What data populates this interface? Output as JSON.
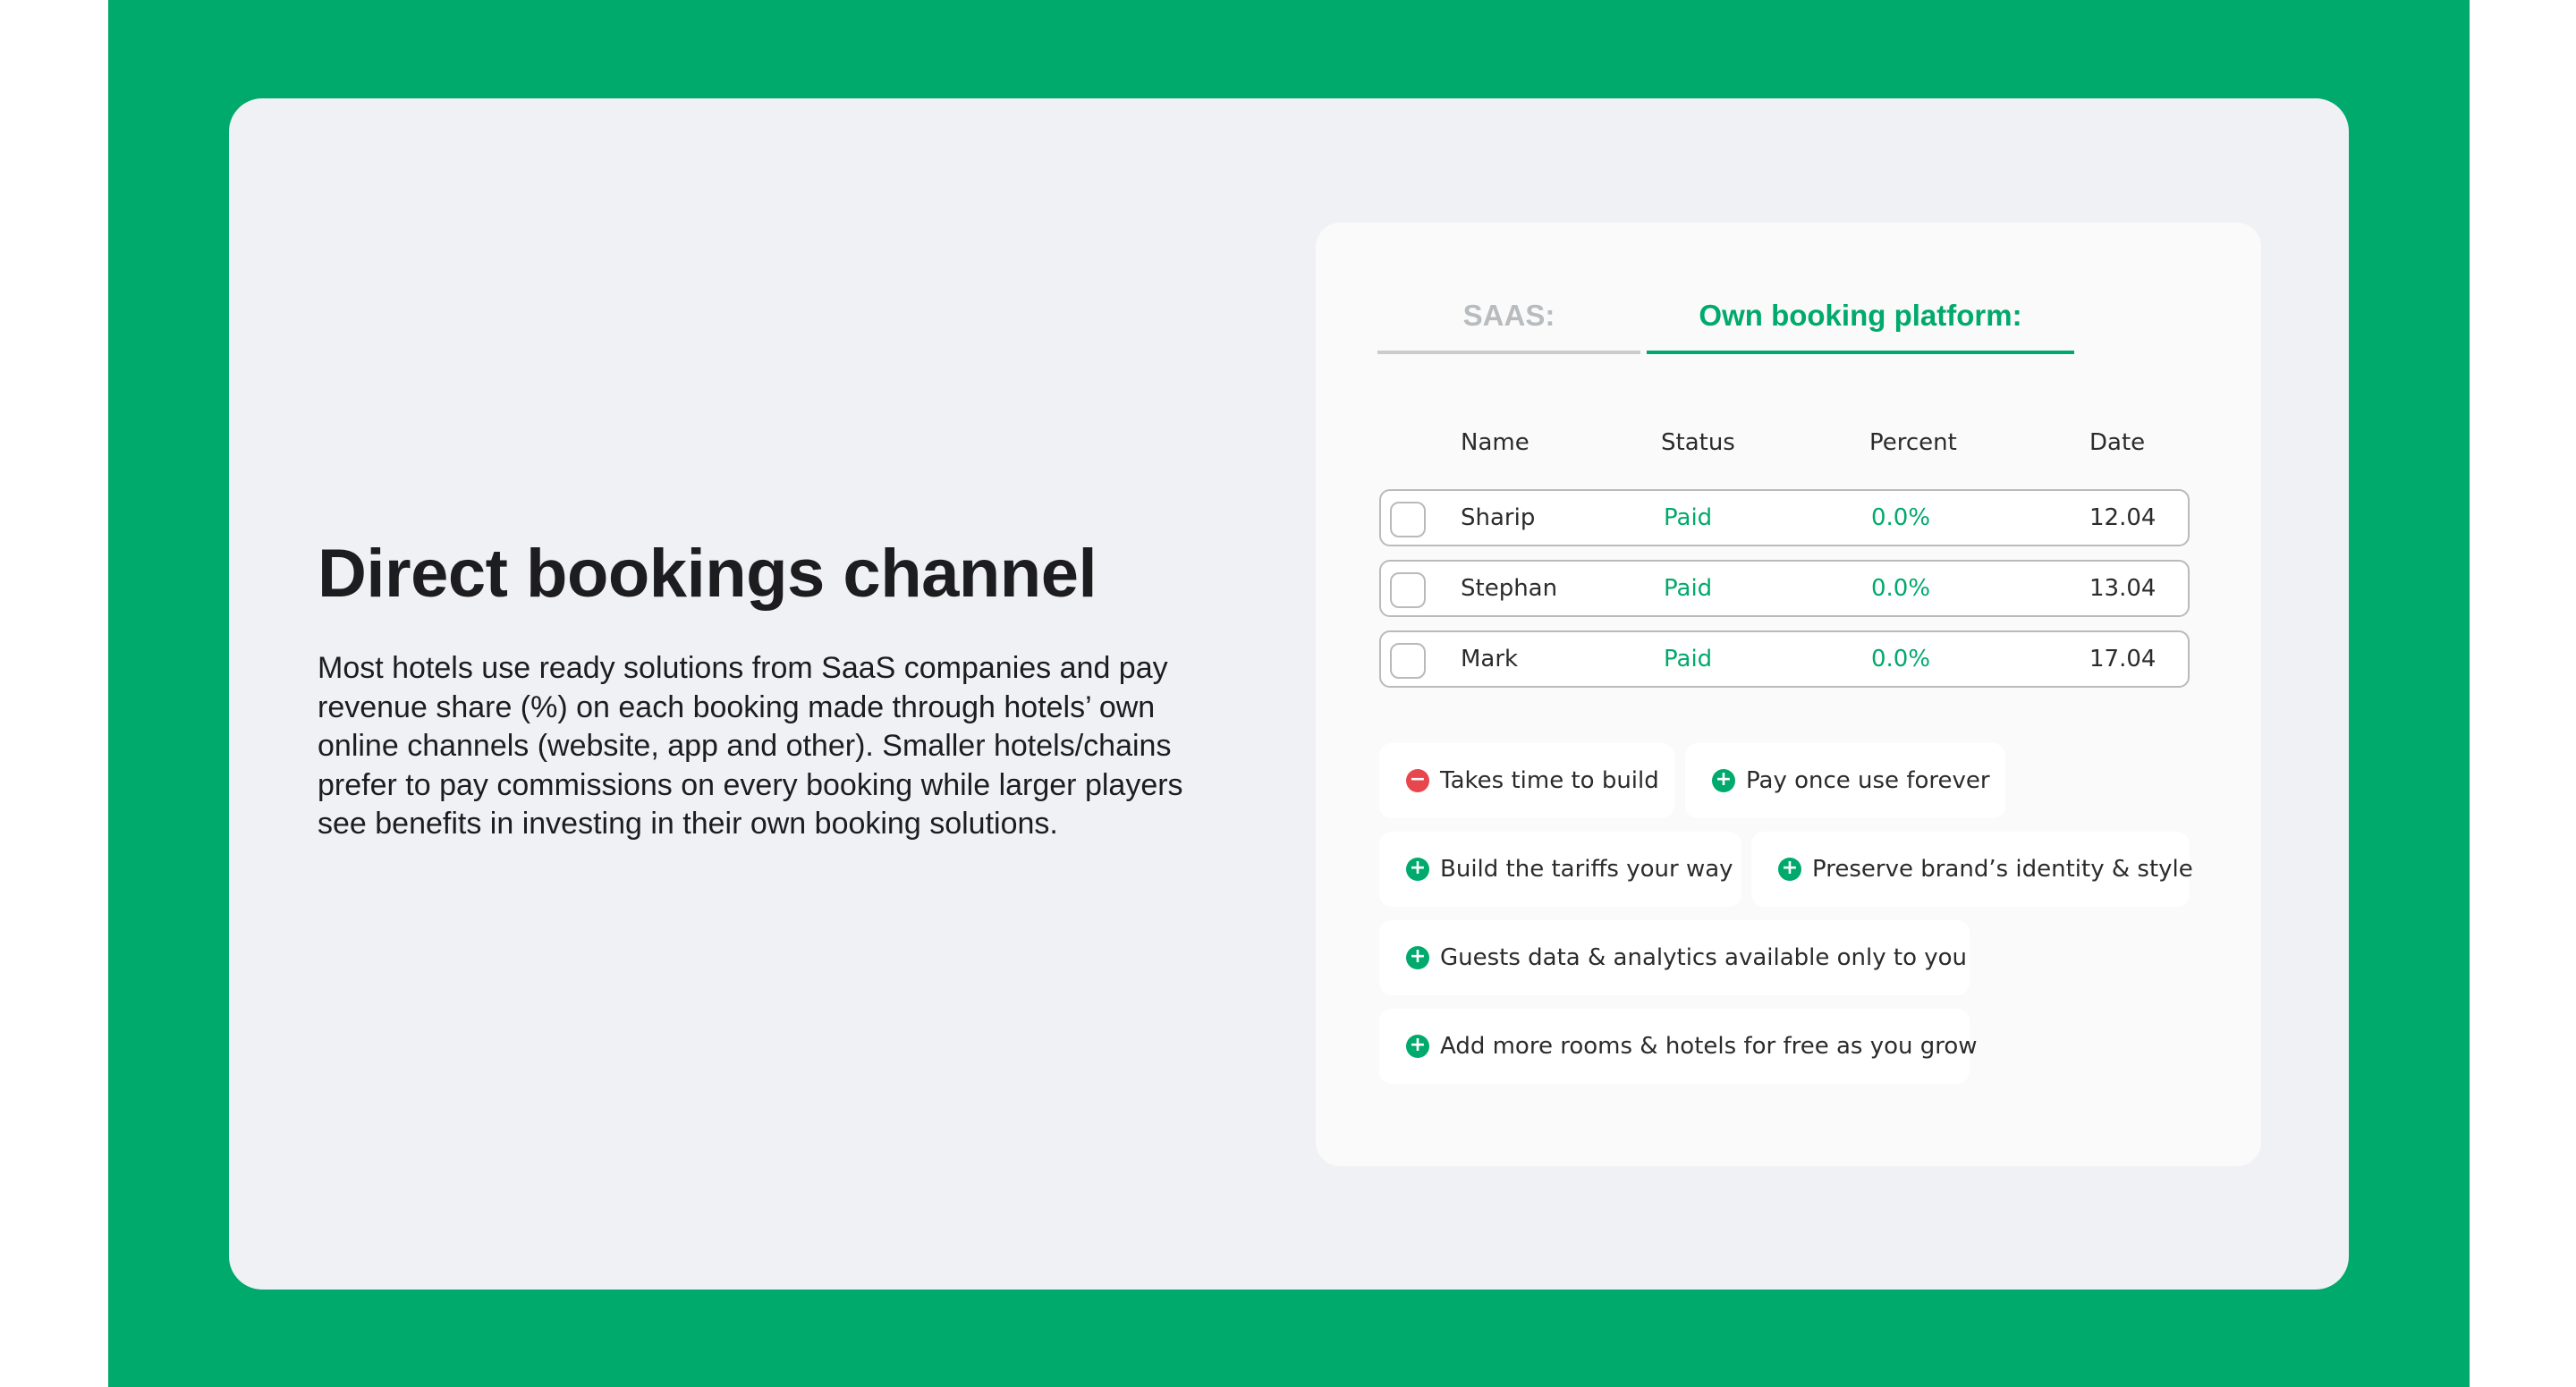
{
  "left": {
    "title": "Direct bookings channel",
    "description": "Most hotels use ready solutions from SaaS companies and pay revenue share (%) on each booking made through hotels’ own online channels (website, app and other). Smaller hotels/chains prefer to pay commissions on every booking while larger players see benefits in investing in their own booking solutions."
  },
  "tabs": [
    {
      "label": "SAAS:",
      "active": false
    },
    {
      "label": "Own booking platform:",
      "active": true
    }
  ],
  "table": {
    "headers": [
      "Name",
      "Status",
      "Percent",
      "Date"
    ],
    "rows": [
      {
        "name": "Sharip",
        "status": "Paid",
        "percent": "0.0%",
        "date": "12.04"
      },
      {
        "name": "Stephan",
        "status": "Paid",
        "percent": "0.0%",
        "date": "13.04"
      },
      {
        "name": "Mark",
        "status": "Paid",
        "percent": "0.0%",
        "date": "17.04"
      }
    ]
  },
  "features": [
    {
      "label": "Takes time to build",
      "kind": "minus",
      "icon": "minus-circle-icon"
    },
    {
      "label": "Pay once use forever",
      "kind": "plus",
      "icon": "plus-circle-icon"
    },
    {
      "label": "Build the tariffs your way",
      "kind": "plus",
      "icon": "plus-circle-icon"
    },
    {
      "label": "Preserve brand’s identity & style",
      "kind": "plus",
      "icon": "plus-circle-icon"
    },
    {
      "label": "Guests data & analytics available only to you",
      "kind": "plus",
      "icon": "plus-circle-icon"
    },
    {
      "label": "Add more rooms & hotels for free as you grow",
      "kind": "plus",
      "icon": "plus-circle-icon"
    }
  ],
  "colors": {
    "accent": "#00a96c",
    "negative": "#e8464d",
    "panel": "#f0f1f4",
    "card": "#fafafa"
  }
}
